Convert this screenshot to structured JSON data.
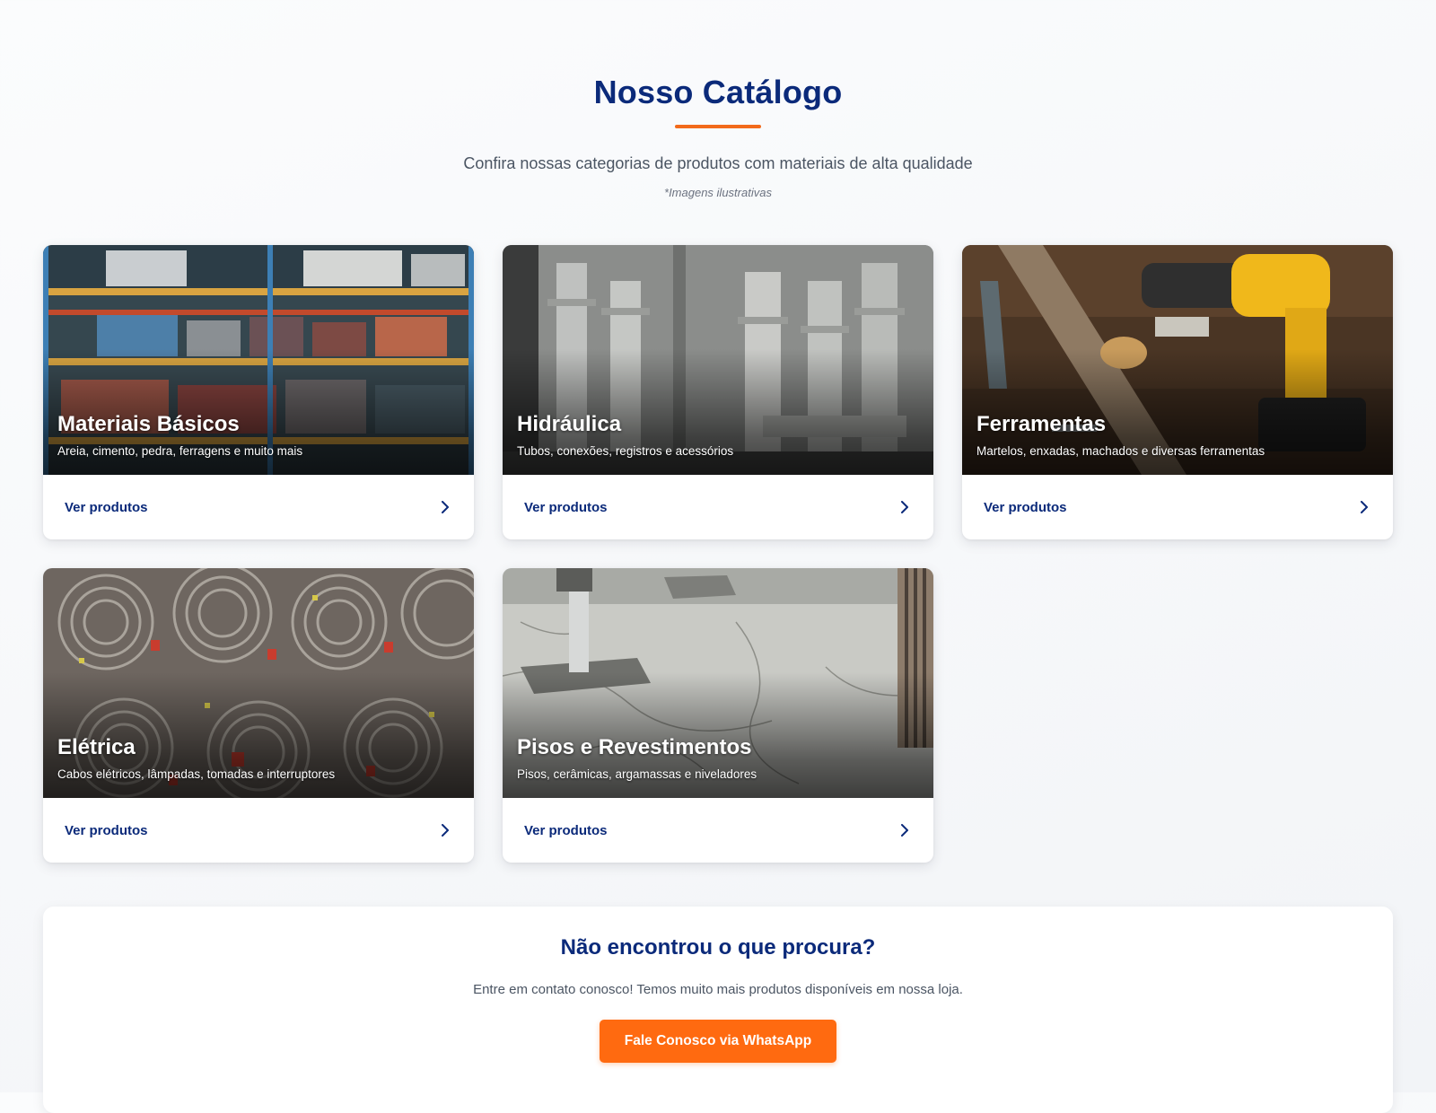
{
  "header": {
    "title": "Nosso Catálogo",
    "subtitle": "Confira nossas categorias de produtos com materiais de alta qualidade",
    "disclaimer": "*Imagens ilustrativas"
  },
  "categories": [
    {
      "title": "Materiais Básicos",
      "description": "Areia, cimento, pedra, ferragens e muito mais",
      "link_label": "Ver produtos",
      "image": "warehouse-shelves-photo"
    },
    {
      "title": "Hidráulica",
      "description": "Tubos, conexões, registros e acessórios",
      "link_label": "Ver produtos",
      "image": "pipes-photo"
    },
    {
      "title": "Ferramentas",
      "description": "Martelos, enxadas, machados e diversas ferramentas",
      "link_label": "Ver produtos",
      "image": "drill-and-tools-photo"
    },
    {
      "title": "Elétrica",
      "description": "Cabos elétricos, lâmpadas, tomadas e interruptores",
      "link_label": "Ver produtos",
      "image": "cable-coils-photo"
    },
    {
      "title": "Pisos e Revestimentos",
      "description": "Pisos, cerâmicas, argamassas e niveladores",
      "link_label": "Ver produtos",
      "image": "marble-floor-photo"
    }
  ],
  "cta": {
    "title": "Não encontrou o que procura?",
    "text": "Entre em contato conosco! Temos muito mais produtos disponíveis em nossa loja.",
    "button_label": "Fale Conosco via WhatsApp"
  },
  "colors": {
    "primary": "#0b2a7a",
    "accent": "#ff6a10",
    "underline": "#f26a1b"
  },
  "icons": {
    "card_arrow": "chevron-right-icon"
  }
}
